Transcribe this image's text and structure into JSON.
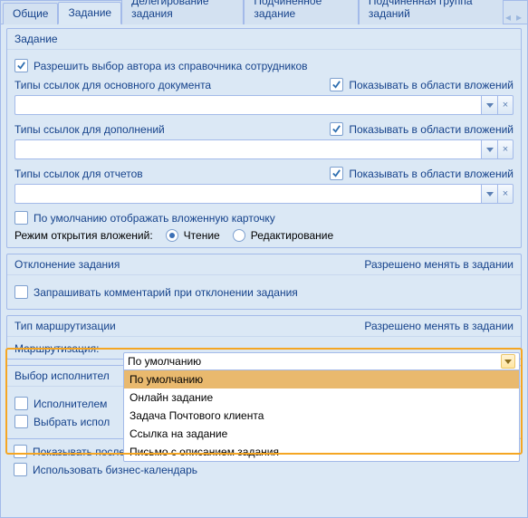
{
  "tabs": {
    "items": [
      "Общие",
      "Задание",
      "Делегирование задания",
      "Подчиненное задание",
      "Подчиненная группа заданий"
    ],
    "active_index": 1
  },
  "task_section": {
    "title": "Задание",
    "allow_author_from_directory": {
      "label": "Разрешить выбор автора из справочника сотрудников",
      "checked": true
    },
    "groups": [
      {
        "title": "Типы ссылок для основного документа",
        "show_label": "Показывать в области вложений",
        "show_checked": true
      },
      {
        "title": "Типы ссылок для дополнений",
        "show_label": "Показывать в области вложений",
        "show_checked": true
      },
      {
        "title": "Типы ссылок для отчетов",
        "show_label": "Показывать в области вложений",
        "show_checked": true
      }
    ],
    "show_nested_card": {
      "label": "По умолчанию отображать вложенную карточку",
      "checked": false
    },
    "open_mode": {
      "caption": "Режим открытия вложений:",
      "options": [
        "Чтение",
        "Редактирование"
      ],
      "selected_index": 0
    }
  },
  "reject_section": {
    "title": "Отклонение задания",
    "right_note": "Разрешено менять в задании",
    "ask_comment": {
      "label": "Запрашивать комментарий при отклонении задания",
      "checked": false
    }
  },
  "route_section": {
    "title": "Тип маршрутизации",
    "right_note": "Разрешено менять в задании",
    "field_label": "Маршрутизация:",
    "selected": "По умолчанию",
    "options": [
      "По умолчанию",
      "Онлайн задание",
      "Задача Почтового клиента",
      "Ссылка на задание",
      "Письмо с описанием задания"
    ]
  },
  "exec_section": {
    "title_partial": "Выбор исполнител",
    "by_executor_partial": "Исполнителем",
    "pick_executor_partial": "Выбрать испол"
  },
  "bottom": {
    "show_last_executors": {
      "label": "Показывать последних исполнителей",
      "checked": false
    },
    "use_biz_calendar": {
      "label": "Использовать бизнес-календарь",
      "checked": false
    }
  },
  "icons": {
    "check": "✓",
    "dropdown": "▾",
    "clear": "×",
    "left": "◂",
    "right": "▸"
  }
}
